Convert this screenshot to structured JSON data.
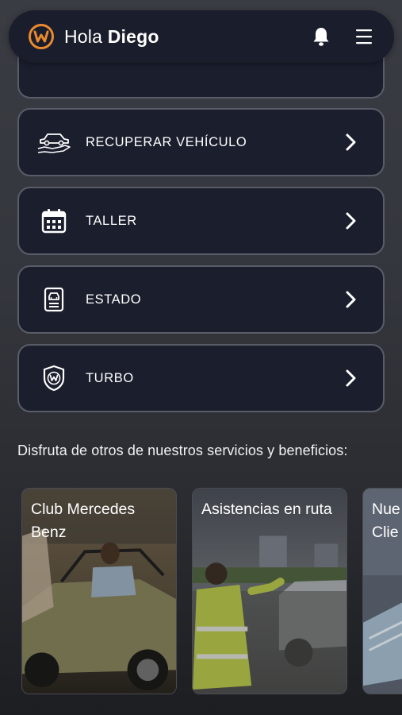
{
  "header": {
    "greeting_prefix": "Hola",
    "user_name": "Diego",
    "logo_icon": "w-logo-icon",
    "notification_icon": "bell-icon",
    "menu_icon": "hamburger-menu-icon"
  },
  "menu": [
    {
      "label": "RECUPERAR VEHÍCULO",
      "icon": "car-in-hand-icon"
    },
    {
      "label": "TALLER",
      "icon": "calendar-icon"
    },
    {
      "label": "ESTADO",
      "icon": "document-car-icon"
    },
    {
      "label": "TURBO",
      "icon": "shield-w-icon"
    }
  ],
  "benefits": {
    "title": "Disfruta de otros de nuestros servicios y beneficios:",
    "cards": [
      {
        "title": "Club Mercedes Benz"
      },
      {
        "title": "Asistencias en ruta"
      },
      {
        "title": "Nue Clie"
      }
    ]
  },
  "colors": {
    "accent": "#e98a2f",
    "card_bg": "#1b1e2d",
    "card_border": "#5a5d68"
  }
}
